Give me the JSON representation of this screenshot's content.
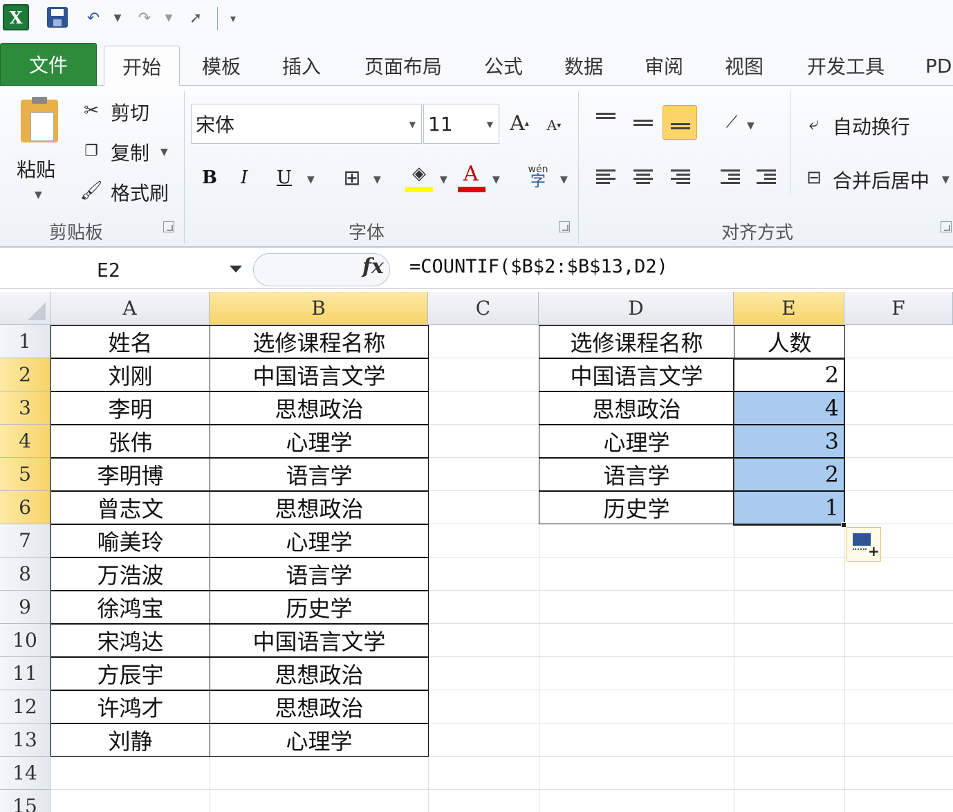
{
  "quick_access": {
    "logo_letter": "X",
    "undo_icon": "undo-icon",
    "redo_icon": "redo-icon"
  },
  "tabs": [
    {
      "label": "文件"
    },
    {
      "label": "开始"
    },
    {
      "label": "模板"
    },
    {
      "label": "插入"
    },
    {
      "label": "页面布局"
    },
    {
      "label": "公式"
    },
    {
      "label": "数据"
    },
    {
      "label": "审阅"
    },
    {
      "label": "视图"
    },
    {
      "label": "开发工具"
    },
    {
      "label": "PD"
    }
  ],
  "ribbon": {
    "clipboard": {
      "paste": "粘贴",
      "cut": "剪切",
      "copy": "复制",
      "format_painter": "格式刷",
      "group_label": "剪贴板"
    },
    "font": {
      "font_name": "宋体",
      "font_size": "11",
      "group_label": "字体",
      "grow": "A",
      "shrink": "A",
      "bold": "B",
      "italic": "I",
      "underline": "U",
      "font_color_letter": "A",
      "phonetic": "wén",
      "highlight_color": "#ffff00",
      "font_color": "#e00000"
    },
    "alignment": {
      "wrap_text": "自动换行",
      "merge_center": "合并后居中",
      "group_label": "对齐方式"
    }
  },
  "formula_bar": {
    "name_box": "E2",
    "fx": "fx",
    "formula": "=COUNTIF($B$2:$B$13,D2)"
  },
  "sheet": {
    "columns": [
      "A",
      "B",
      "C",
      "D",
      "E",
      "F"
    ],
    "rows": [
      "1",
      "2",
      "3",
      "4",
      "5",
      "6",
      "7",
      "8",
      "9",
      "10",
      "11",
      "12",
      "13",
      "14",
      "15"
    ],
    "table1": {
      "header": [
        "姓名",
        "选修课程名称"
      ],
      "rows": [
        [
          "刘刚",
          "中国语言文学"
        ],
        [
          "李明",
          "思想政治"
        ],
        [
          "张伟",
          "心理学"
        ],
        [
          "李明博",
          "语言学"
        ],
        [
          "曾志文",
          "思想政治"
        ],
        [
          "喻美玲",
          "心理学"
        ],
        [
          "万浩波",
          "语言学"
        ],
        [
          "徐鸿宝",
          "历史学"
        ],
        [
          "宋鸿达",
          "中国语言文学"
        ],
        [
          "方辰宇",
          "思想政治"
        ],
        [
          "许鸿才",
          "思想政治"
        ],
        [
          "刘静",
          "心理学"
        ]
      ]
    },
    "table2": {
      "header": [
        "选修课程名称",
        "人数"
      ],
      "rows": [
        [
          "中国语言文学",
          "2"
        ],
        [
          "思想政治",
          "4"
        ],
        [
          "心理学",
          "3"
        ],
        [
          "语言学",
          "2"
        ],
        [
          "历史学",
          "1"
        ]
      ]
    },
    "selection_color": "#a9cbf0",
    "header_highlight_color": "#f7d46a"
  }
}
